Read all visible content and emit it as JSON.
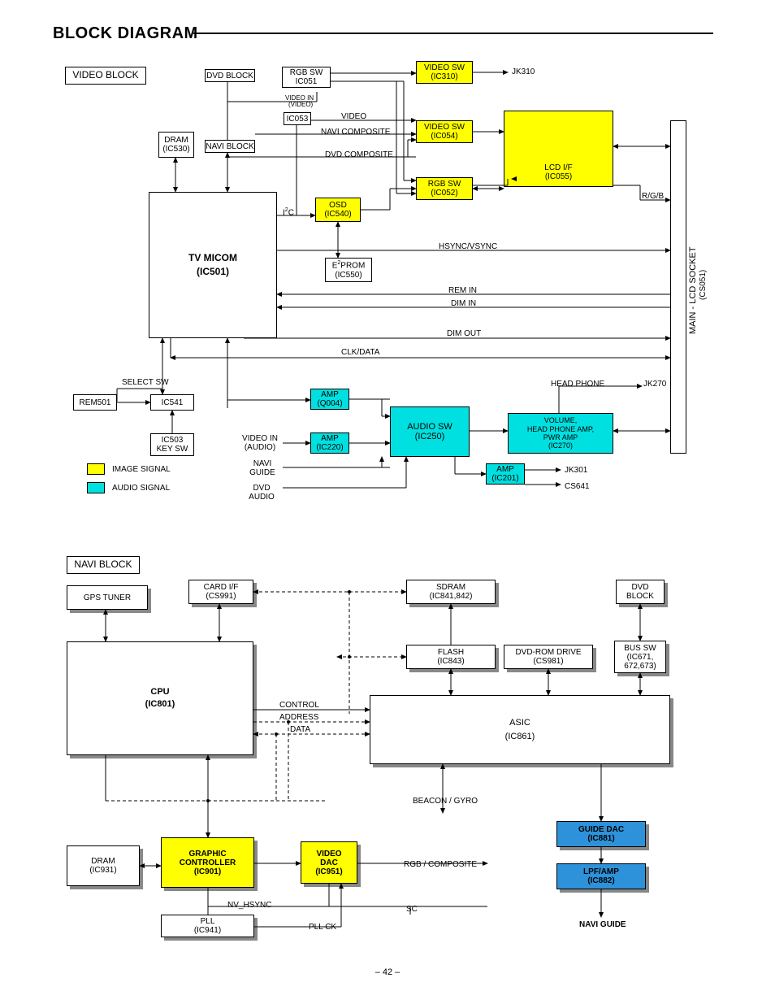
{
  "page": {
    "title": "BLOCK DIAGRAM",
    "number": "– 42 –"
  },
  "video": {
    "section_label": "VIDEO BLOCK",
    "dvd_block": "DVD BLOCK",
    "navi_block": "NAVI BLOCK",
    "rgb_sw1": {
      "l1": "RGB SW",
      "l2": "IC051"
    },
    "video_in_video": {
      "l1": "VIDEO IN",
      "l2": "(VIDEO)"
    },
    "ic053": "IC053",
    "video_txt": "VIDEO",
    "navi_composite": "NAVI  COMPOSITE",
    "dvd_composite": "DVD COMPOSITE",
    "video_sw1": {
      "l1": "VIDEO SW",
      "l2": "(IC310)"
    },
    "video_sw2": {
      "l1": "VIDEO SW",
      "l2": "(IC054)"
    },
    "lcd_if": {
      "l1": "LCD I/F",
      "l2": "(IC055)"
    },
    "rgb_sw2": {
      "l1": "RGB SW",
      "l2": "(IC052)"
    },
    "osd": {
      "l1": "OSD",
      "l2": "(IC540)"
    },
    "dram": {
      "l1": "DRAM",
      "l2": "(IC530)"
    },
    "tv_micom": {
      "l1": "TV MICOM",
      "l2": "(IC501)"
    },
    "i2c": "I",
    "i2c2": "C",
    "i2c_sup": "2",
    "e2prom": {
      "l1a": "E",
      "l1sup": "2",
      "l1b": "PROM",
      "l2": "(IC550)"
    },
    "hsync": "HSYNC/VSYNC",
    "rem_in": "REM IN",
    "dim_in": "DIM IN",
    "dim_out": "DIM OUT",
    "clk_data": "CLK/DATA",
    "jk310": "JK310",
    "rgb": "R/G/B",
    "socket": {
      "l1": "MAIN - LCD SOCKET",
      "l2": "(CS051)"
    },
    "select_sw": "SELECT SW",
    "rem501": "REM501",
    "ic541": "IC541",
    "ic503": {
      "l1": "IC503",
      "l2": "KEY SW"
    },
    "video_in_audio": {
      "l1": "VIDEO IN",
      "l2": "(AUDIO)"
    },
    "navi_guide": {
      "l1": "NAVI",
      "l2": "GUIDE"
    },
    "dvd_audio": {
      "l1": "DVD",
      "l2": "AUDIO"
    },
    "amp_q004": {
      "l1": "AMP",
      "l2": "(Q004)"
    },
    "amp_ic220": {
      "l1": "AMP",
      "l2": "(IC220)"
    },
    "audio_sw": {
      "l1": "AUDIO SW",
      "l2": "(IC250)"
    },
    "amp_ic201": {
      "l1": "AMP",
      "l2": "(IC201)"
    },
    "volume": {
      "l1": "VOLUME,",
      "l2": "HEAD PHONE AMP,",
      "l3": "PWR AMP",
      "l4": "(IC270)"
    },
    "headphone": "HEAD PHONE",
    "jk270": "JK270",
    "jk301": "JK301",
    "cs641": "CS641",
    "legend_img": "IMAGE SIGNAL",
    "legend_aud": "AUDIO SIGNAL"
  },
  "navi": {
    "section_label": "NAVI BLOCK",
    "gps": "GPS TUNER",
    "card_if": {
      "l1": "CARD I/F",
      "l2": "(CS991)"
    },
    "sdram": {
      "l1": "SDRAM",
      "l2": "(IC841,842)"
    },
    "dvd_block": {
      "l1": "DVD",
      "l2": "BLOCK"
    },
    "flash": {
      "l1": "FLASH",
      "l2": "(IC843)"
    },
    "dvd_rom": {
      "l1": "DVD-ROM DRIVE",
      "l2": "(CS981)"
    },
    "bus_sw": {
      "l1": "BUS SW",
      "l2": "(IC671,",
      "l3": "672,673)"
    },
    "cpu": {
      "l1": "CPU",
      "l2": "(IC801)"
    },
    "control": "CONTROL",
    "address": "ADDRESS",
    "data": "DATA",
    "asic": {
      "l1": "ASIC",
      "l2": "(IC861)"
    },
    "beacon": "BEACON / GYRO",
    "dram": {
      "l1": "DRAM",
      "l2": "(IC931)"
    },
    "graphic": {
      "l1": "GRAPHIC",
      "l2": "CONTROLLER",
      "l3": "(IC901)"
    },
    "video_dac": {
      "l1": "VIDEO",
      "l2": "DAC",
      "l3": "(IC951)"
    },
    "guide_dac": {
      "l1": "GUIDE DAC",
      "l2": "(IC881)"
    },
    "lpf": {
      "l1": "LPF/AMP",
      "l2": "(IC882)"
    },
    "rgb_comp": "RGB / COMPOSITE",
    "nv_hsync": "NV_HSYNC",
    "pll": {
      "l1": "PLL",
      "l2": "(IC941)"
    },
    "pll_ck": "PLL CK",
    "sc": "SC",
    "navi_guide": "NAVI GUIDE"
  }
}
